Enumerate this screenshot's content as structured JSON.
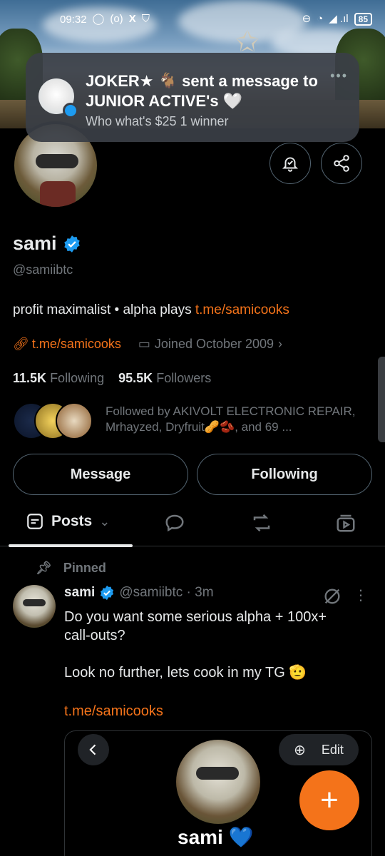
{
  "status_bar": {
    "time": "09:32",
    "battery": "85"
  },
  "notification": {
    "title": "JOKER★ 🐐 sent a message to JUNIOR ACTIVE's 🤍",
    "body": "Who what's $25 1 winner"
  },
  "profile": {
    "name": "sami",
    "handle": "@samiibtc",
    "bio_text": "profit maximalist • alpha plays ",
    "bio_link": "t.me/samicooks",
    "website": "t.me/samicooks",
    "joined": "Joined October 2009",
    "following_count": "11.5K",
    "following_label": "Following",
    "followers_count": "95.5K",
    "followers_label": "Followers",
    "followed_by": "Followed by AKIVOLT ELECTRONIC REPAIR, Mrhayzed, Dryfruit🥜🫘, and 69 ...",
    "message_button": "Message",
    "following_button": "Following"
  },
  "tabs": {
    "posts_label": "Posts"
  },
  "post": {
    "pinned_label": "Pinned",
    "author": "sami",
    "handle_time": "@samiibtc · 3m",
    "text": "Do you want some serious alpha + 100x+\ncall-outs?\n\nLook no further, lets cook in my TG 🫡",
    "link": "t.me/samicooks",
    "media_edit_label": "Edit",
    "media_name": "sami 💙"
  },
  "colors": {
    "accent": "#f4731a",
    "verified": "#1d9bf0",
    "muted": "#71767b"
  }
}
